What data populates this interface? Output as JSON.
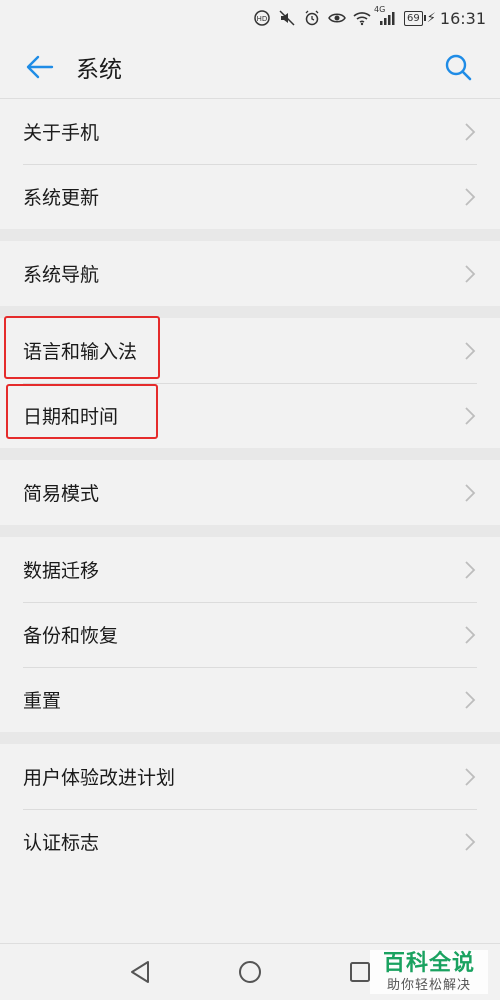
{
  "status_bar": {
    "battery": "69",
    "network": "4G",
    "time": "16:31"
  },
  "app_bar": {
    "title": "系统"
  },
  "settings": {
    "groups": [
      {
        "items": [
          {
            "label": "关于手机"
          },
          {
            "label": "系统更新"
          }
        ]
      },
      {
        "items": [
          {
            "label": "系统导航"
          }
        ]
      },
      {
        "items": [
          {
            "label": "语言和输入法"
          },
          {
            "label": "日期和时间"
          }
        ]
      },
      {
        "items": [
          {
            "label": "简易模式"
          }
        ]
      },
      {
        "items": [
          {
            "label": "数据迁移"
          },
          {
            "label": "备份和恢复"
          },
          {
            "label": "重置"
          }
        ]
      },
      {
        "items": [
          {
            "label": "用户体验改进计划"
          },
          {
            "label": "认证标志"
          }
        ]
      }
    ]
  },
  "watermark": {
    "title": "百科全说",
    "subtitle": "助你轻松解决"
  },
  "colors": {
    "accent": "#1f8ce6",
    "highlight": "#e52b2b",
    "watermark": "#1aa260"
  }
}
